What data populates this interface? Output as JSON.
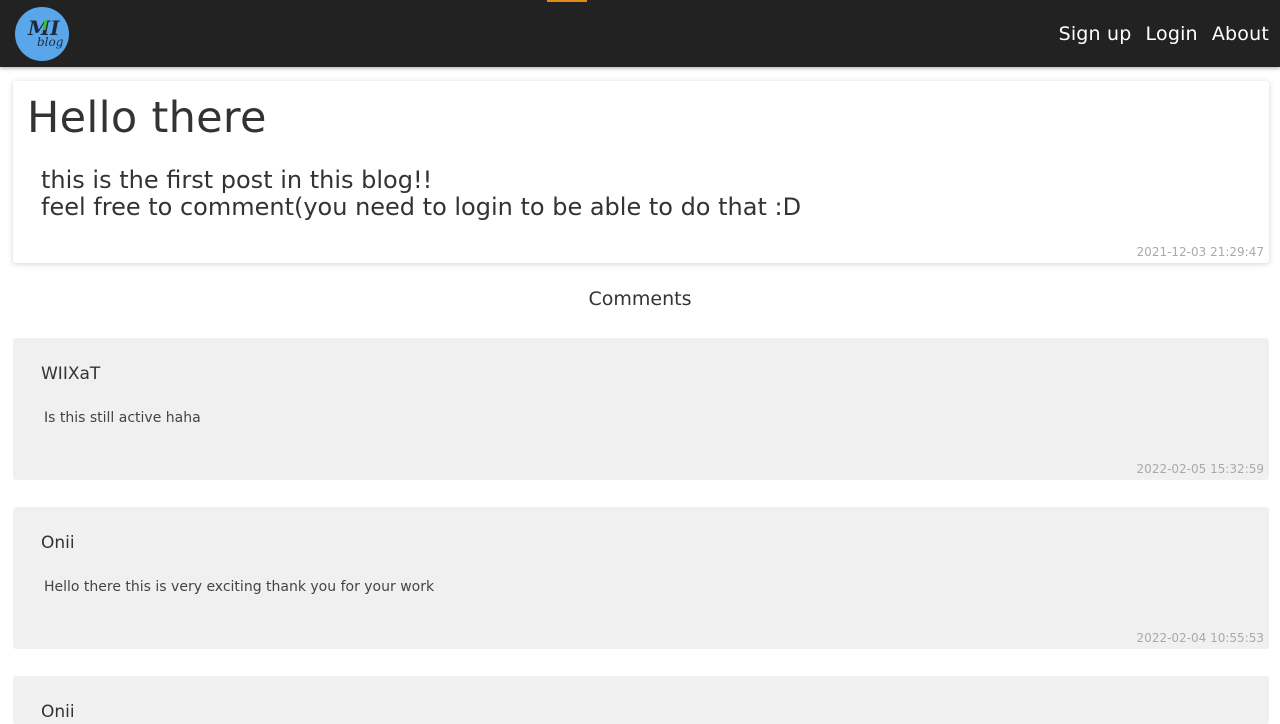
{
  "navbar": {
    "logo": {
      "primary_text": "MI",
      "secondary_text": "blog",
      "icon": "blog-logo-icon"
    },
    "links": [
      "Sign up",
      "Login",
      "About"
    ]
  },
  "post": {
    "title": "Hello there",
    "body_lines": [
      "this is the first post in this blog!!",
      "feel free to comment(you need to login to be able to do that :D"
    ],
    "timestamp": "2021-12-03 21:29:47"
  },
  "comments_heading": "Comments",
  "comments": [
    {
      "author": "WIIXaT",
      "text": "Is this still active haha",
      "timestamp": "2022-02-05 15:32:59"
    },
    {
      "author": "Onii",
      "text": "Hello there this is very exciting thank you for your work",
      "timestamp": "2022-02-04 10:55:53"
    },
    {
      "author": "Onii",
      "text": "",
      "timestamp": ""
    }
  ],
  "colors": {
    "navbar_bg": "#222222",
    "accent": "#e08a1e",
    "logo_bg": "#5aa6ea",
    "comment_bg": "#f0f0f0"
  }
}
